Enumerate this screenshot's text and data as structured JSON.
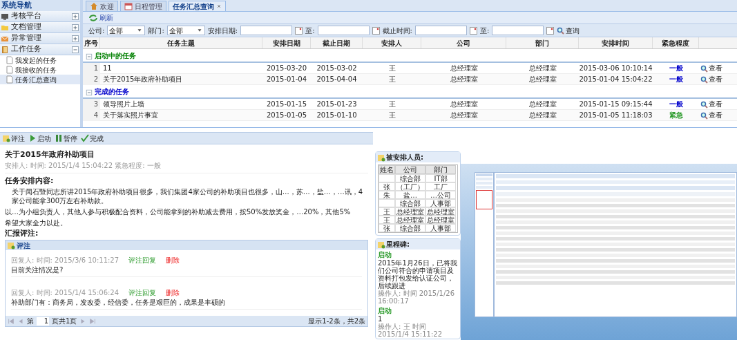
{
  "sidebar": {
    "title": "系统导航",
    "sections": [
      {
        "label": "考核平台",
        "expanded": false
      },
      {
        "label": "文档管理",
        "expanded": false
      },
      {
        "label": "异常管理",
        "expanded": false
      },
      {
        "label": "工作任务",
        "expanded": true,
        "children": [
          {
            "label": "我发起的任务",
            "selected": false
          },
          {
            "label": "我接收的任务",
            "selected": false
          },
          {
            "label": "任务汇总查询",
            "selected": true
          }
        ]
      }
    ]
  },
  "tabs": [
    {
      "label": "欢迎",
      "selected": false
    },
    {
      "label": "日程管理",
      "selected": false
    },
    {
      "label": "任务汇总查询",
      "selected": true,
      "closable": true
    }
  ],
  "toolbar": {
    "refresh": "刷新"
  },
  "filters": {
    "company_label": "公司:",
    "company": "全部",
    "dept_label": "部门:",
    "dept": "全部",
    "plan_label": "安排日期:",
    "to1": "至:",
    "due_label": "截止时间:",
    "to2": "至:",
    "query": "查询"
  },
  "table": {
    "columns": [
      "序号",
      "任务主题",
      "安排日期",
      "截止日期",
      "安排人",
      "公司",
      "部门",
      "安排时间",
      "紧急程度"
    ],
    "groups": [
      {
        "title": "启动中的任务",
        "color": "#008000",
        "rows": [
          {
            "no": "1",
            "subject": "11",
            "plan": "2015-03-20",
            "due": "2015-03-02",
            "assigner": "王",
            "company": "总经理室",
            "dept": "总经理室",
            "time": "2015-03-06 10:10:14",
            "urgency": "一般",
            "color": "#0000cc",
            "action": "查看"
          },
          {
            "no": "2",
            "subject": "关于2015年政府补助项目",
            "plan": "2015-01-04",
            "due": "2015-04-04",
            "assigner": "王",
            "company": "总经理室",
            "dept": "总经理室",
            "time": "2015-01-04 15:04:22",
            "urgency": "一般",
            "color": "#0000cc",
            "action": "查看"
          }
        ]
      },
      {
        "title": "完成的任务",
        "color": "#0000cc",
        "rows": [
          {
            "no": "3",
            "subject": "领导照片上墙",
            "plan": "2015-01-15",
            "due": "2015-01-23",
            "assigner": "王",
            "company": "总经理室",
            "dept": "总经理室",
            "time": "2015-01-15 09:15:44",
            "urgency": "一般",
            "color": "#0000cc",
            "action": "查看"
          },
          {
            "no": "4",
            "subject": "关于落实照片事宜",
            "plan": "2015-01-05",
            "due": "2015-01-10",
            "assigner": "王",
            "company": "总经理室",
            "dept": "总经理室",
            "time": "2015-01-05 11:18:03",
            "urgency": "紧急",
            "color": "#2a9a2a",
            "action": "查看"
          }
        ]
      }
    ]
  },
  "detail": {
    "actions": [
      "评注",
      "启动",
      "暂停",
      "完成"
    ],
    "title": "关于2015年政府补助项目",
    "meta": "安排人: 时间: 2015/1/4 15:04:22 紧急程度: 一般",
    "content_heading": "任务安排内容:",
    "paragraphs": [
      "关于闻石暨同志所讲2015年政府补助项目很多，我们集团4家公司的补助项目也很多，山…，苏…，盐…，…讯，4家公司能拿300万左右补助款。",
      "以…为小组负责人，其他人参与积极配合资料，公司能拿到的补助减去费用，按50%发放奖金，…20%，其他5%",
      "希望大家全力以赴。"
    ],
    "report_heading": "汇报评注:",
    "comments_title": "评注",
    "comments": [
      {
        "meta": "回复人: 时间: 2015/3/6 10:11:27",
        "reply": "评注回复",
        "delete": "删除",
        "body": "目前关注情况是?"
      },
      {
        "meta": "回复人: 时间: 2015/1/4 15:06:24",
        "reply": "评注回复",
        "delete": "删除",
        "body": "补助部门有：商务局，发改委，经信委，任务是艰巨的，成果是丰硕的"
      }
    ],
    "pager": {
      "prefix": "第",
      "page": "1",
      "suffix": "页共1页",
      "summary": "显示1-2条，共2条"
    }
  },
  "assignees": {
    "title": "被安排人员:",
    "columns": [
      "姓名",
      "公司",
      "部门"
    ],
    "rows": [
      {
        "company": "综合部",
        "dept": "IT部"
      },
      {
        "name": "张",
        "company": "（工厂）",
        "dept": "工厂"
      },
      {
        "name": "朱",
        "company": "盐…",
        "dept": "…公司"
      },
      {
        "company": "综合部",
        "dept": "人事部"
      },
      {
        "name": "王",
        "company": "总经理室",
        "dept": "总经理室"
      },
      {
        "name": "王",
        "company": "总经理室",
        "dept": "总经理室"
      },
      {
        "name": "张",
        "company": "综合部",
        "dept": "人事部"
      }
    ]
  },
  "milestones": {
    "title": "里程碑:",
    "items": [
      {
        "status": "启动",
        "text": "2015年1月26日，已将我们公司符合的申请项目及资料打包发给认证公司，后续跟进",
        "meta": "操作人: 时间 2015/1/26 16:00:17"
      },
      {
        "status": "启动",
        "text": "1",
        "meta": "操作人: 王 时间 2015/1/4 15:11:22"
      }
    ]
  }
}
